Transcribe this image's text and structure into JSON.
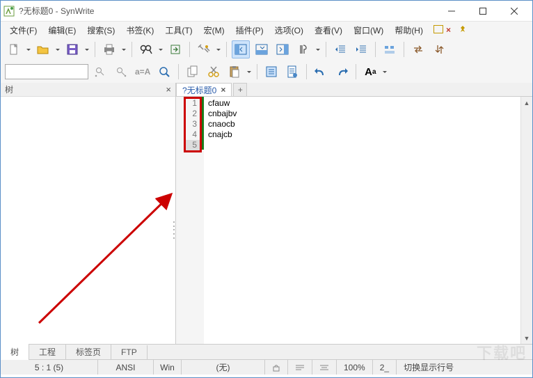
{
  "window": {
    "title": "?无标题0 - SynWrite"
  },
  "menu": {
    "file": "文件(F)",
    "edit": "编辑(E)",
    "search": "搜索(S)",
    "bookmarks": "书签(K)",
    "tools": "工具(T)",
    "macros": "宏(M)",
    "plugins": "插件(P)",
    "options": "选项(O)",
    "view": "查看(V)",
    "window": "窗口(W)",
    "help": "帮助(H)"
  },
  "tree": {
    "title": "树"
  },
  "tabs": {
    "doc0": "?无标题0",
    "close": "×",
    "plus": "+"
  },
  "code": {
    "lines": [
      "cfauw",
      "cnbajbv",
      "cnaocb",
      "cnajcb",
      ""
    ],
    "numbers": [
      "1",
      "2",
      "3",
      "4",
      "5"
    ]
  },
  "bottom_tabs": {
    "tree": "树",
    "project": "工程",
    "tabs": "标签页",
    "ftp": "FTP"
  },
  "status": {
    "pos": "5 : 1 (5)",
    "encoding": "ANSI",
    "lineend": "Win",
    "lang": "(无)",
    "zoom": "100%",
    "tabsize": "2_",
    "message": "切换显示行号"
  },
  "watermark": "下载吧"
}
